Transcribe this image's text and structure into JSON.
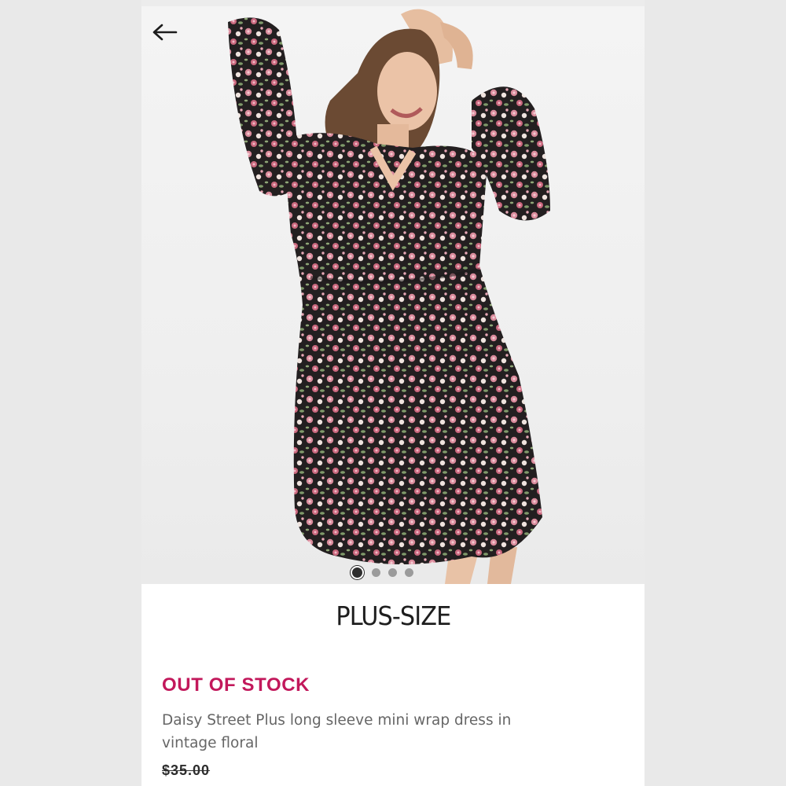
{
  "product": {
    "image_alt": "Model wearing floral long sleeve mini wrap dress",
    "carousel": {
      "total": 4,
      "active": 1
    },
    "size_tag": "PLUS-SIZE",
    "stock_status": "OUT OF STOCK",
    "title": "Daisy Street Plus long sleeve mini wrap dress in vintage floral",
    "price": "$35.00"
  },
  "icons": {
    "back": "arrow-left-icon"
  },
  "colors": {
    "stock_status": "#c2185b",
    "background": "#ffffff",
    "text_muted": "#666666"
  }
}
